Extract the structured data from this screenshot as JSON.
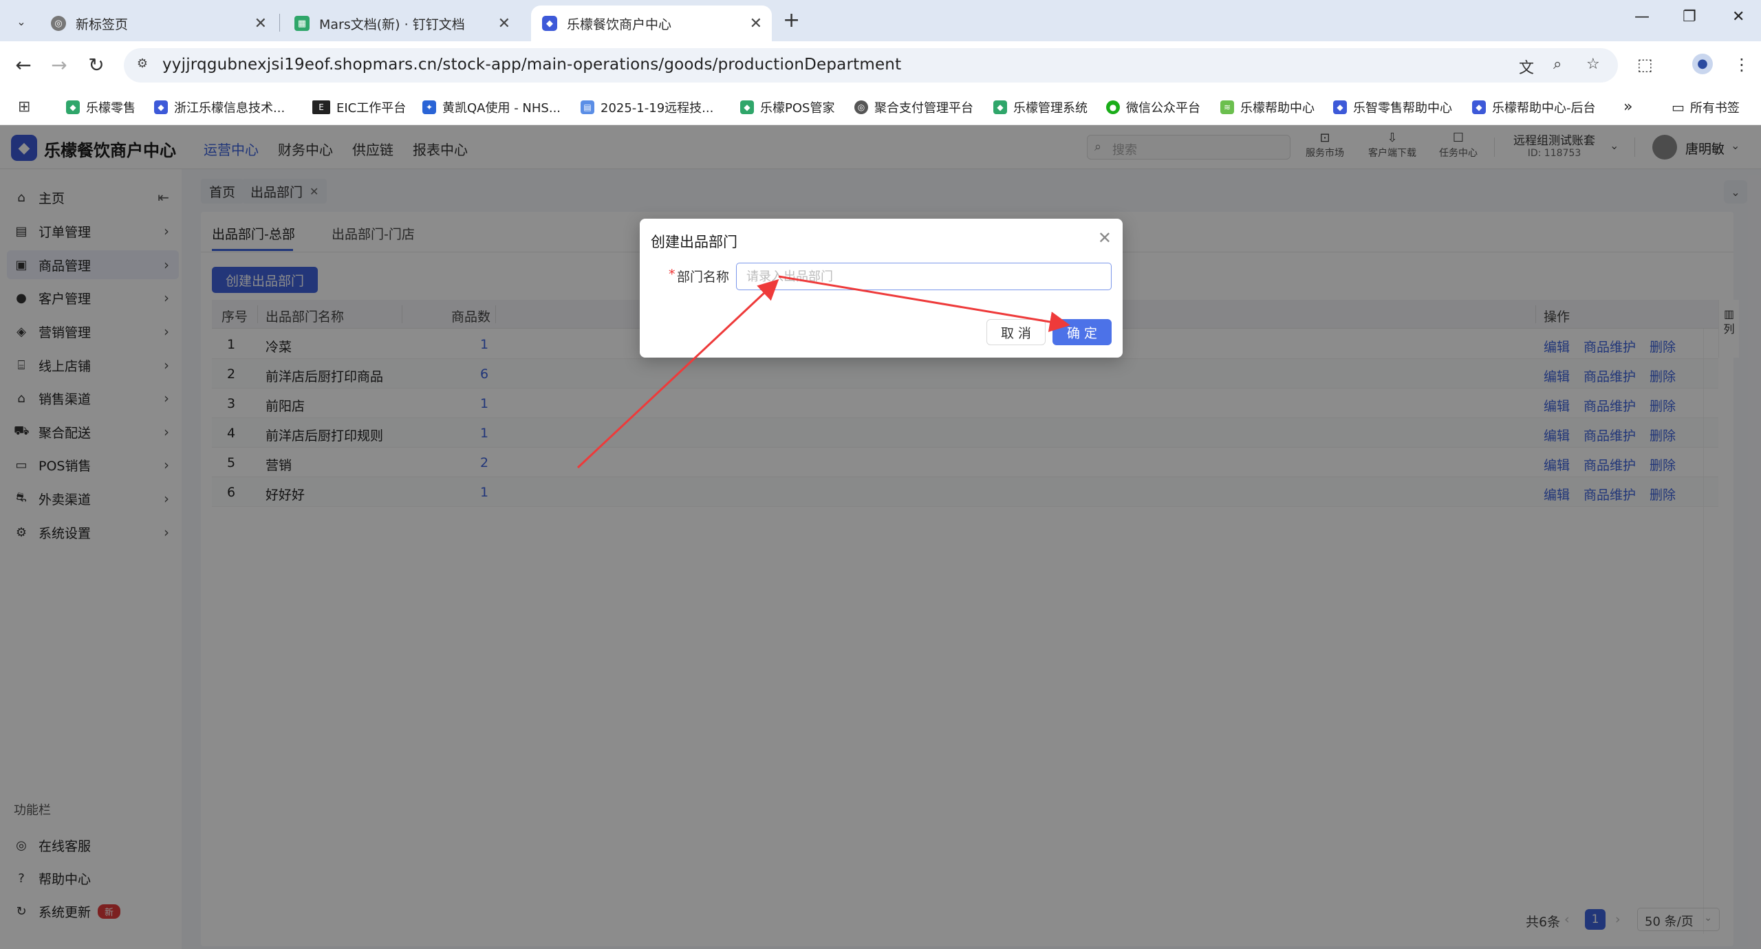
{
  "browser": {
    "tabs": [
      {
        "title": "新标签页"
      },
      {
        "title": "Mars文档(新) · 钉钉文档"
      },
      {
        "title": "乐檬餐饮商户中心"
      }
    ],
    "url": "yyjjrqgubnexjsi19eof.shopmars.cn/stock-app/main-operations/goods/productionDepartment",
    "bookmarks": [
      "乐檬零售",
      "浙江乐檬信息技术...",
      "EIC工作平台",
      "黄凯QA使用 - NHS...",
      "2025-1-19远程技...",
      "乐檬POS管家",
      "聚合支付管理平台",
      "乐檬管理系统",
      "微信公众平台",
      "乐檬帮助中心",
      "乐智零售帮助中心",
      "乐檬帮助中心-后台"
    ],
    "all_bookmarks": "所有书签",
    "colors": {
      "accent": "#3d63dd",
      "primary_button": "#4163dd",
      "danger": "#e33b3b"
    }
  },
  "app": {
    "name": "乐檬餐饮商户中心",
    "topnav": [
      "运营中心",
      "财务中心",
      "供应链",
      "报表中心"
    ],
    "search_placeholder": "搜索",
    "tools": [
      "服务市场",
      "客户端下载",
      "任务中心"
    ],
    "account_name": "远程组测试账套",
    "account_id": "ID: 118753",
    "user_name": "唐明敏"
  },
  "sidebar": {
    "items": [
      {
        "label": "主页",
        "icon": "home-icon"
      },
      {
        "label": "订单管理",
        "icon": "order-icon"
      },
      {
        "label": "商品管理",
        "icon": "goods-icon"
      },
      {
        "label": "客户管理",
        "icon": "user-icon"
      },
      {
        "label": "营销管理",
        "icon": "tag-icon"
      },
      {
        "label": "线上店铺",
        "icon": "store-icon"
      },
      {
        "label": "销售渠道",
        "icon": "bank-icon"
      },
      {
        "label": "聚合配送",
        "icon": "delivery-icon"
      },
      {
        "label": "POS销售",
        "icon": "pos-icon"
      },
      {
        "label": "外卖渠道",
        "icon": "motorbike-icon"
      },
      {
        "label": "系统设置",
        "icon": "gear-icon"
      }
    ],
    "section_title": "功能栏",
    "footer_items": [
      {
        "label": "在线客服",
        "icon": "headset-icon"
      },
      {
        "label": "帮助中心",
        "icon": "help-icon"
      },
      {
        "label": "系统更新",
        "icon": "refresh-icon",
        "badge": "新"
      }
    ]
  },
  "content": {
    "breadcrumbs": [
      "首页",
      "出品部门"
    ],
    "subtabs": [
      "出品部门-总部",
      "出品部门-门店"
    ],
    "create_button": "创建出品部门",
    "table": {
      "headers": [
        "序号",
        "出品部门名称",
        "商品数",
        "操作"
      ],
      "col_setting": "列",
      "rows": [
        {
          "no": "1",
          "name": "冷菜",
          "count": "1"
        },
        {
          "no": "2",
          "name": "前洋店后厨打印商品",
          "count": "6"
        },
        {
          "no": "3",
          "name": "前阳店",
          "count": "1"
        },
        {
          "no": "4",
          "name": "前洋店后厨打印规则",
          "count": "1"
        },
        {
          "no": "5",
          "name": "营销",
          "count": "2"
        },
        {
          "no": "6",
          "name": "好好好",
          "count": "1"
        }
      ],
      "actions": [
        "编辑",
        "商品维护",
        "删除"
      ]
    },
    "pagination": {
      "total": "共6条",
      "current_page": "1",
      "page_size": "50 条/页"
    }
  },
  "modal": {
    "title": "创建出品部门",
    "required_mark": "*",
    "field_label": "部门名称",
    "field_placeholder": "请录入出品部门",
    "field_value": "",
    "cancel": "取 消",
    "ok": "确 定"
  }
}
